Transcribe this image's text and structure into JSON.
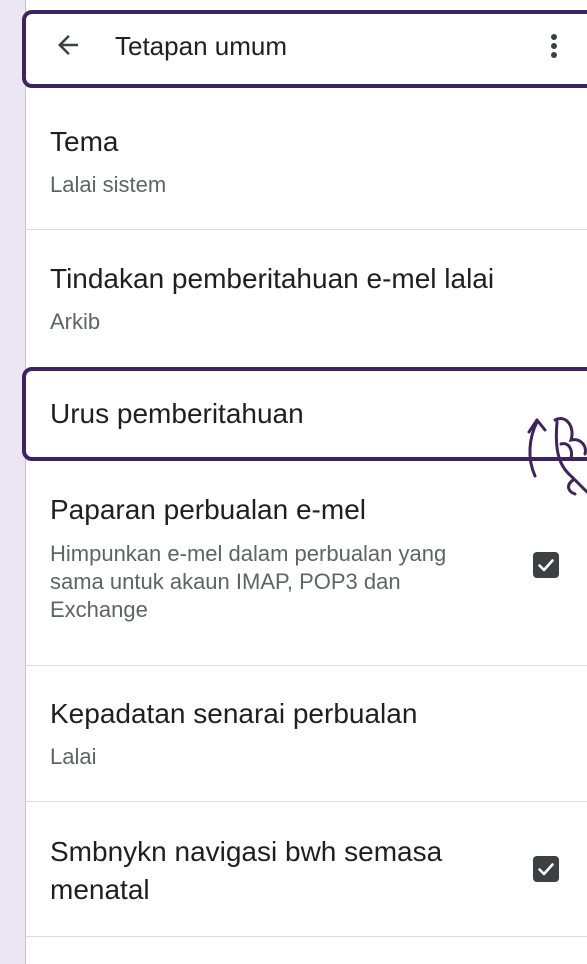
{
  "header": {
    "back_icon": "arrow-left-icon",
    "title": "Tetapan umum",
    "more_icon": "more-vertical-icon"
  },
  "settings": [
    {
      "title": "Tema",
      "subtitle": "Lalai sistem"
    },
    {
      "title": "Tindakan pemberitahuan e-mel lalai",
      "subtitle": "Arkib"
    },
    {
      "title": "Urus pemberitahuan"
    },
    {
      "title": "Paparan perbualan e-mel",
      "subtitle": "Himpunkan e-mel dalam perbualan yang sama untuk akaun IMAP, POP3 dan Exchange",
      "checked": true
    },
    {
      "title": "Kepadatan senarai perbualan",
      "subtitle": "Lalai"
    },
    {
      "title": "Smbnykn navigasi bwh semasa menatal",
      "checked": true
    }
  ],
  "colors": {
    "highlight": "#3e2360",
    "backdrop": "#ece6f2",
    "checkbox": "#3c4043"
  }
}
